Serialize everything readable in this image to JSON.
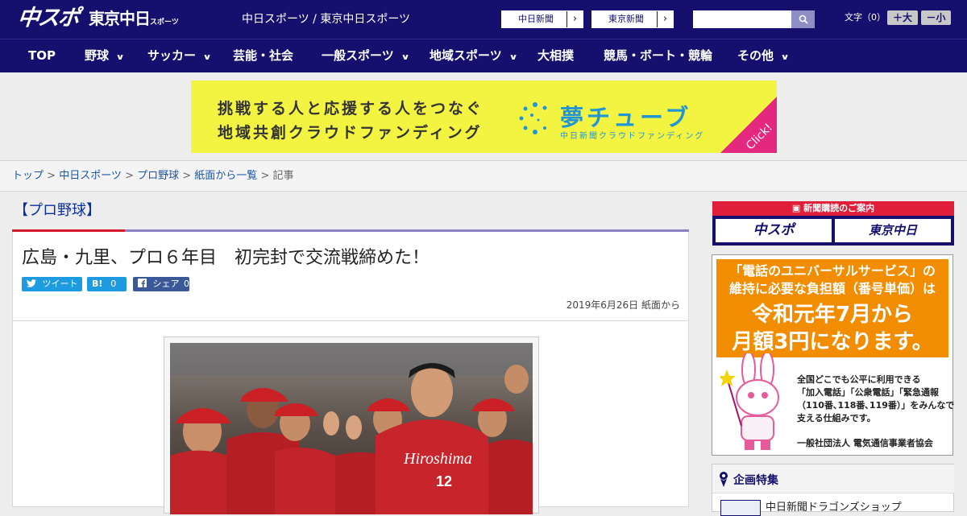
{
  "header": {
    "logo_chuspo": "中スポ",
    "logo_tokyo": "東京中日",
    "logo_tokyo_sub": "スポーツ",
    "site_names": "中日スポーツ / 東京中日スポーツ",
    "chunichi_link": "中日新聞",
    "tokyo_link": "東京新聞",
    "search_placeholder": "",
    "font_size_label": "文字（0）",
    "font_bigger": "＋大",
    "font_smaller": "－小",
    "colors": {
      "navy": "#15106e",
      "accent_red": "#d3192a"
    }
  },
  "nav": {
    "items": [
      {
        "label": "TOP",
        "has_menu": false
      },
      {
        "label": "野球",
        "has_menu": true
      },
      {
        "label": "サッカー",
        "has_menu": true
      },
      {
        "label": "芸能・社会",
        "has_menu": false
      },
      {
        "label": "一般スポーツ",
        "has_menu": true
      },
      {
        "label": "地域スポーツ",
        "has_menu": true
      },
      {
        "label": "大相撲",
        "has_menu": false
      },
      {
        "label": "競馬・ボート・競輪",
        "has_menu": false
      },
      {
        "label": "その他",
        "has_menu": true
      }
    ]
  },
  "banner": {
    "line1": "挑戦する人と応援する人をつなぐ",
    "line2": "地域共創クラウドファンディング",
    "title": "夢チューブ",
    "sub": "中日新聞クラウドファンディング",
    "click": "Click!"
  },
  "breadcrumb": {
    "items": [
      "トップ",
      "中日スポーツ",
      "プロ野球",
      "紙面から一覧"
    ],
    "current": "記事",
    "sep": " > "
  },
  "article": {
    "category": "【プロ野球】",
    "headline": "広島・九里、プロ６年目　初完封で交流戦締めた！",
    "tweet_label": "ツイート",
    "hatena_label": "B!",
    "hatena_count": "0",
    "facebook_label": "シェア",
    "facebook_count": "0",
    "date": "2019年6月26日 紙面から"
  },
  "sidebar": {
    "subscribe_title": "新聞購読のご案内",
    "subscribe_chuspo": "中スポ",
    "subscribe_tokyo": "東京中日",
    "ad": {
      "line1": "「電話のユニバーサルサービス」の",
      "line2": "維持に必要な負担額（番号単価）は",
      "line3": "令和元年7月から",
      "line4": "月額3円になります。",
      "body": "全国どこでも公平に利用できる\n「加入電話」「公衆電話」「緊急通報\n（110番､118番､119番）」をみんなで\n支える仕組みです。",
      "org": "一般社団法人 電気通信事業者協会"
    },
    "feature_title": "企画特集",
    "feature_item": "中日新聞ドラゴンズショップ"
  }
}
